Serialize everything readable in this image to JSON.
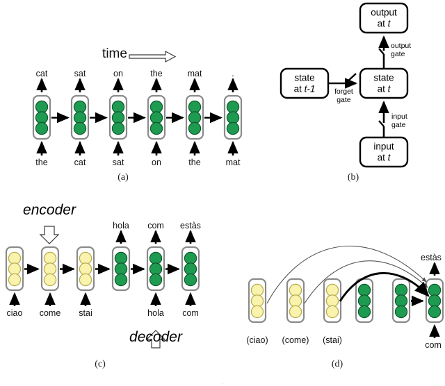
{
  "figure": {
    "panels": [
      "a",
      "b",
      "c",
      "d"
    ],
    "captions": {
      "a": "(a)",
      "b": "(b)",
      "c": "(c)",
      "d": "(d)"
    },
    "bottom_cut_text": "."
  },
  "panel_a": {
    "time_label": "time",
    "time_arrow": "hollow-right-arrow",
    "outputs": [
      "cat",
      "sat",
      "on",
      "the",
      "mat",
      "."
    ],
    "inputs": [
      "the",
      "cat",
      "sat",
      "on",
      "the",
      "mat"
    ],
    "cell_color": "green",
    "cell_count": 6,
    "units_per_cell": 3
  },
  "panel_b": {
    "boxes": [
      {
        "id": "output-t",
        "line1": "output",
        "line2_prefix": "at ",
        "line2_var": "t"
      },
      {
        "id": "state-t-1",
        "line1": "state",
        "line2_prefix": "at ",
        "line2_var": "t-1"
      },
      {
        "id": "state-t",
        "line1": "state",
        "line2_prefix": "at ",
        "line2_var": "t"
      },
      {
        "id": "input-t",
        "line1": "input",
        "line2_prefix": "at ",
        "line2_var": "t"
      }
    ],
    "gates": [
      {
        "id": "output-gate",
        "line1": "output",
        "line2": "gate"
      },
      {
        "id": "forget-gate",
        "line1": "forget",
        "line2": "gate"
      },
      {
        "id": "input-gate",
        "line1": "input",
        "line2": "gate"
      }
    ]
  },
  "panel_c": {
    "encoder_label": "encoder",
    "decoder_label": "decoder",
    "encoder_arrow": "hollow-down-arrow",
    "decoder_arrow": "hollow-up-arrow",
    "cells": [
      {
        "color": "yellow",
        "input": "ciao",
        "output": ""
      },
      {
        "color": "yellow",
        "input": "come",
        "output": ""
      },
      {
        "color": "yellow",
        "input": "stai",
        "output": ""
      },
      {
        "color": "green",
        "input": "",
        "output": "hola"
      },
      {
        "color": "green",
        "input": "hola",
        "output": "com"
      },
      {
        "color": "green",
        "input": "com",
        "output": "estàs"
      }
    ]
  },
  "panel_d": {
    "cells": [
      {
        "color": "yellow",
        "label": "(ciao)"
      },
      {
        "color": "yellow",
        "label": "(come)"
      },
      {
        "color": "yellow",
        "label": "(stai)"
      },
      {
        "color": "green",
        "label": ""
      },
      {
        "color": "green",
        "label": ""
      },
      {
        "color": "green",
        "label": ""
      }
    ],
    "output_label": "estàs",
    "input_label": "com",
    "attention_arcs": [
      {
        "from": "(ciao)",
        "to": "last-cell",
        "weight": "thin"
      },
      {
        "from": "(come)",
        "to": "last-cell",
        "weight": "thin"
      },
      {
        "from": "(stai)",
        "to": "last-cell",
        "weight": "thick"
      }
    ]
  },
  "colors": {
    "green_fill": "#1f9a51",
    "green_stroke": "#0c5c2c",
    "yellow_fill": "#f9f3ad",
    "yellow_stroke": "#b9ad4e",
    "cell_border": "#8a8a8a",
    "line": "#000000",
    "arc_thin": "#555555"
  }
}
